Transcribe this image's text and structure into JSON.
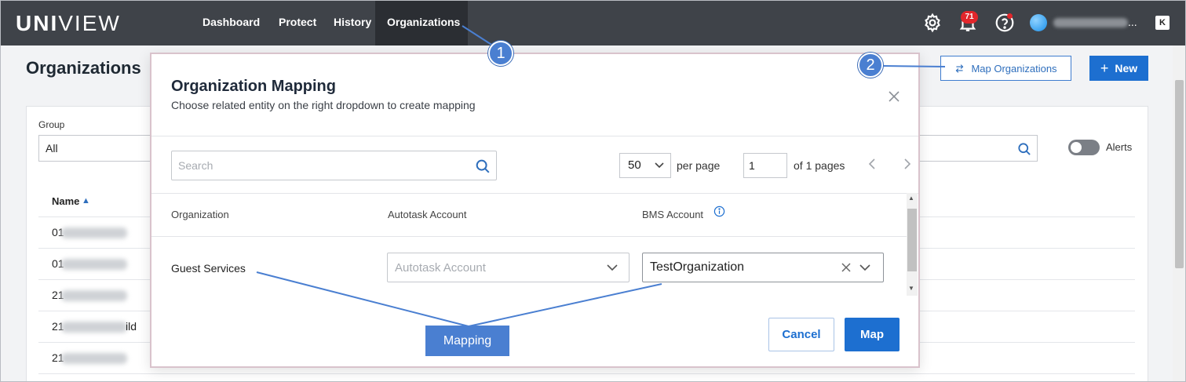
{
  "topbar": {
    "logo_bold": "UNI",
    "logo_light": "VIEW",
    "nav": [
      "Dashboard",
      "Protect",
      "History",
      "Organizations"
    ],
    "notification_count": "71",
    "user_ellipsis": "...",
    "k_icon": "K",
    "icons": [
      "gear-icon",
      "bell-icon",
      "help-icon",
      "avatar"
    ]
  },
  "page": {
    "title": "Organizations",
    "map_org_label": "Map Organizations",
    "new_label": "New",
    "group_label": "Group",
    "group_value": "All",
    "alerts_label": "Alerts",
    "name_header": "Name",
    "rows": [
      "01",
      "01",
      "21",
      "21",
      "21"
    ],
    "row4_suffix": "ild"
  },
  "modal": {
    "title": "Organization Mapping",
    "subtitle": "Choose related entity on the right dropdown to create mapping",
    "search_placeholder": "Search",
    "per_page_value": "50",
    "per_page_label": "per page",
    "page_value": "1",
    "of_pages": "of 1 pages",
    "columns": [
      "Organization",
      "Autotask Account",
      "BMS Account"
    ],
    "row": {
      "organization": "Guest Services",
      "autotask_placeholder": "Autotask Account",
      "bms_value": "TestOrganization"
    },
    "cancel_label": "Cancel",
    "map_label": "Map"
  },
  "annotations": {
    "callout_1": "1",
    "callout_2": "2",
    "mapping_label": "Mapping",
    "color": "#4a7fd1"
  },
  "colors": {
    "topbar": "#3f4349",
    "primary": "#1d6fd0",
    "badge": "#e2262b"
  }
}
